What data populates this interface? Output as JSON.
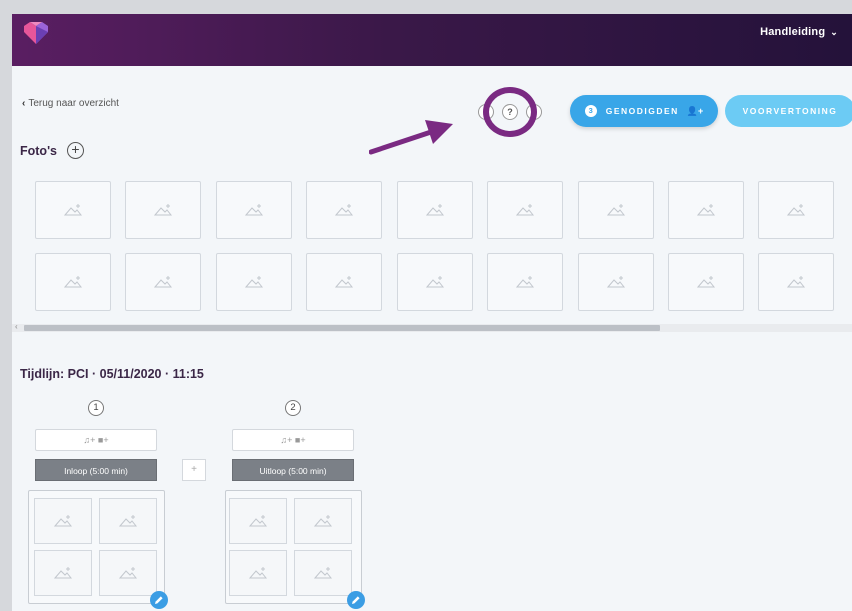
{
  "header": {
    "menu_label": "Handleiding",
    "menu_chevron": "⌄",
    "brand_colors": [
      "#5a1e62",
      "#24123a"
    ]
  },
  "toolbar": {
    "back_arrow": "‹",
    "back_label": "Terug naar overzicht",
    "help_label": "?",
    "guests_count": "3",
    "guests_label": "GENODIGDEN",
    "guests_icon": "👤+",
    "preview_label": "VOORVERTONING",
    "accent": "#39a6e8"
  },
  "photos": {
    "title": "Foto's",
    "add_label": "+"
  },
  "timeline": {
    "title": "Tijdlijn: PCI · 05/11/2020 · 11:15",
    "media_label": "♫+  ■+",
    "add_label": "+",
    "segments": [
      {
        "number": "1",
        "label": "Inloop (5:00 min)"
      },
      {
        "number": "2",
        "label": "Uitloop (5:00 min)"
      }
    ]
  },
  "icons": {
    "image_placeholder": "image-add-icon",
    "edit": "pencil-icon",
    "help": "question-icon"
  }
}
